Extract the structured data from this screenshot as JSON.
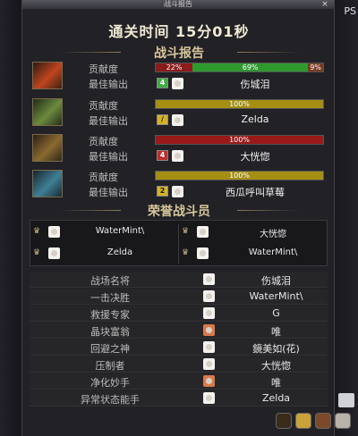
{
  "window": {
    "title": "战斗报告",
    "clear_time": "通关时间   15分01秒"
  },
  "sections": {
    "battle_report": "战斗报告",
    "honor": "荣誉战斗员"
  },
  "labels": {
    "contribution": "贡献度",
    "best_output": "最佳输出"
  },
  "players": [
    {
      "segments": [
        {
          "text": "22%",
          "pct": 22,
          "color": "#8b1c1c"
        },
        {
          "text": "69%",
          "pct": 69,
          "color": "#2e9a2e"
        },
        {
          "text": "9%",
          "pct": 9,
          "color": "#7b3a22"
        }
      ],
      "badge": "4",
      "badge_color": "#3fae3f",
      "name": "伤城泪",
      "portrait_color": "#c1451f"
    },
    {
      "segments": [
        {
          "text": "100%",
          "pct": 100,
          "color": "#a58f13"
        }
      ],
      "badge": "/",
      "badge_color": "#d6b323",
      "name": "Zelda",
      "portrait_color": "#6c8a3e"
    },
    {
      "segments": [
        {
          "text": "100%",
          "pct": 100,
          "color": "#9a1a1a"
        }
      ],
      "badge": "4",
      "badge_color": "#c12b2b",
      "name": "大恍惚",
      "portrait_color": "#8a6a30"
    },
    {
      "segments": [
        {
          "text": "100%",
          "pct": 100,
          "color": "#a58f13"
        }
      ],
      "badge": "2",
      "badge_color": "#d6b323",
      "name": "西瓜呼叫草莓",
      "portrait_color": "#3f7f96"
    }
  ],
  "honor_members": [
    "WaterMint\\",
    "大恍惚",
    "Zelda",
    "WaterMint\\"
  ],
  "awards": [
    {
      "title": "战场名将",
      "name": "伤城泪"
    },
    {
      "title": "一击决胜",
      "name": "WaterMint\\"
    },
    {
      "title": "救援专家",
      "name": "G"
    },
    {
      "title": "晶块富翁",
      "name": "唯"
    },
    {
      "title": "回避之神",
      "name": "鏡美如(花)"
    },
    {
      "title": "压制者",
      "name": "大恍惚"
    },
    {
      "title": "净化妙手",
      "name": "唯"
    },
    {
      "title": "异常状态能手",
      "name": "Zelda"
    }
  ],
  "background": {
    "corner_text": "PS"
  },
  "icons": [
    "close-icon",
    "crown-icon",
    "chevron-icon",
    "house-icon"
  ]
}
